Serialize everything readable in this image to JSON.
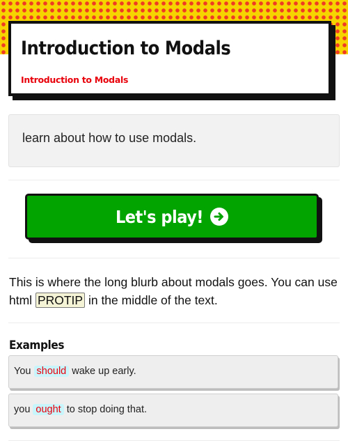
{
  "header": {
    "title": "Introduction to Modals",
    "subtitle": "Introduction to Modals"
  },
  "description": "learn about how to use modals.",
  "play_button": {
    "label": "Let's play!",
    "icon": "arrow-circle-right-icon"
  },
  "blurb": {
    "before": "This is where the long blurb about modals goes. You can use html ",
    "protip": "PROTIP",
    "after": " in the middle of the text."
  },
  "examples": {
    "heading": "Examples",
    "items": [
      {
        "before": "You ",
        "highlight": "should",
        "after": " wake up early."
      },
      {
        "before": "you ",
        "highlight": "ought",
        "after": " to stop doing that."
      }
    ]
  },
  "colors": {
    "pattern_background": "#f5d400",
    "pattern_dots": "#ef3b24",
    "accent_red": "#e8000b",
    "play_green": "#02a400",
    "highlight_cyan": "#c8f4fb"
  }
}
